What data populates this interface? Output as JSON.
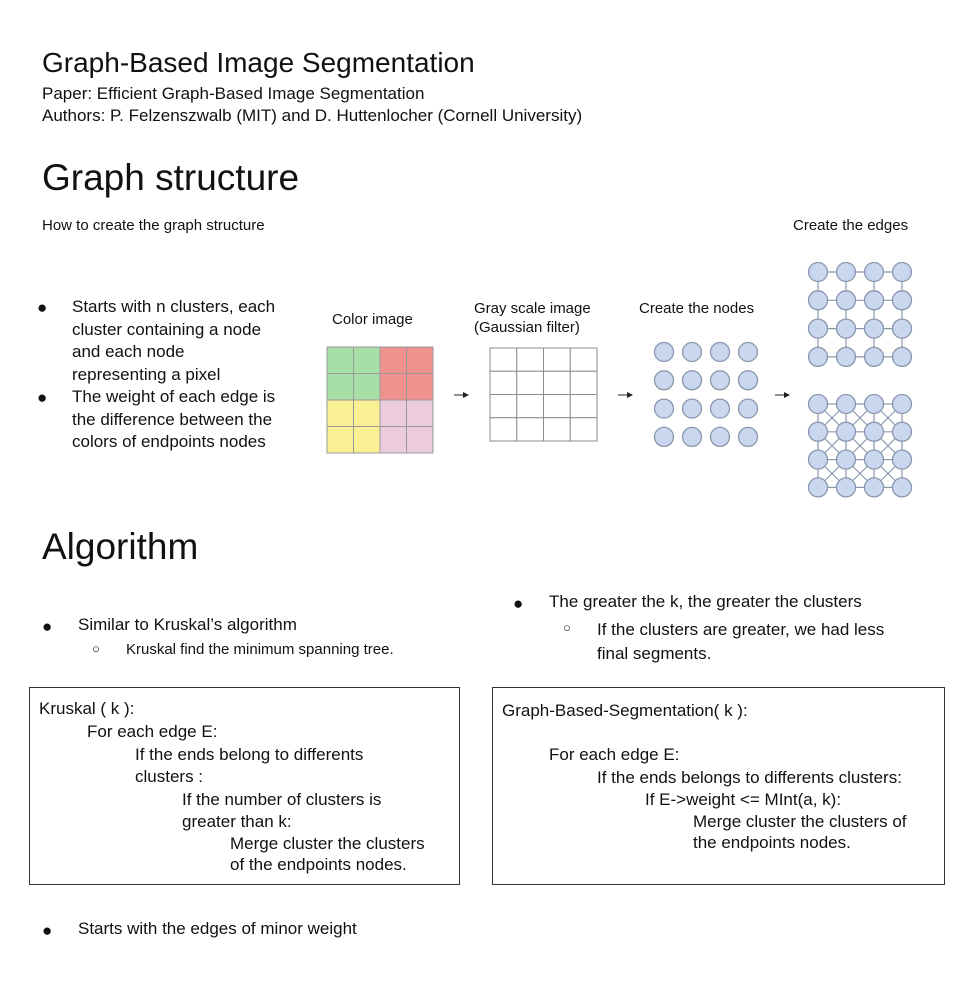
{
  "header": {
    "title": "Graph-Based Image Segmentation",
    "paper": "Paper: Efficient Graph-Based Image Segmentation",
    "authors": "Authors: P. Felzenszwalb (MIT) and D. Huttenlocher (Cornell University)"
  },
  "graph_section": {
    "heading": "Graph structure",
    "caption": "How to create the graph structure",
    "edges_label": "Create the edges",
    "bullets": [
      [
        "Starts with n clusters, each",
        "cluster containing a node",
        "and each node",
        "representing a pixel"
      ],
      [
        "The weight of each edge is",
        "the difference between the",
        "colors of  endpoints nodes"
      ]
    ],
    "color_image_label": "Color image",
    "gray_label_1": "Gray scale image",
    "gray_label_2": "(Gaussian filter)",
    "nodes_label": "Create the nodes",
    "colors": {
      "green": "#a8dfa6",
      "red": "#f0938f",
      "yellow": "#f9ef93",
      "pink": "#ebcbdc",
      "node_fill": "#c9d7ef",
      "node_stroke": "#8a97ad"
    }
  },
  "algorithm_section": {
    "heading": "Algorithm",
    "left_bullet": "Similar to Kruskal’s algorithm",
    "left_sub_bullet": "Kruskal find the minimum spanning tree.",
    "right_bullet": "The greater the k, the greater the clusters",
    "right_sub_bullet": [
      "If the clusters are greater, we had less",
      "final segments."
    ],
    "kruskal_code": [
      "Kruskal ( k ):",
      "For each edge E:",
      "If the ends belong to differents",
      "clusters :",
      "If the number of clusters is",
      "greater than k:",
      "Merge cluster the clusters",
      "of the endpoints nodes."
    ],
    "gbs_code": [
      "Graph-Based-Segmentation( k ):",
      "For each edge E:",
      "If the ends belongs to differents clusters:",
      "If E->weight <= MInt(a, k):",
      "Merge cluster the clusters of",
      "the endpoints nodes."
    ],
    "bottom_bullet": "Starts with the edges of minor weight"
  }
}
